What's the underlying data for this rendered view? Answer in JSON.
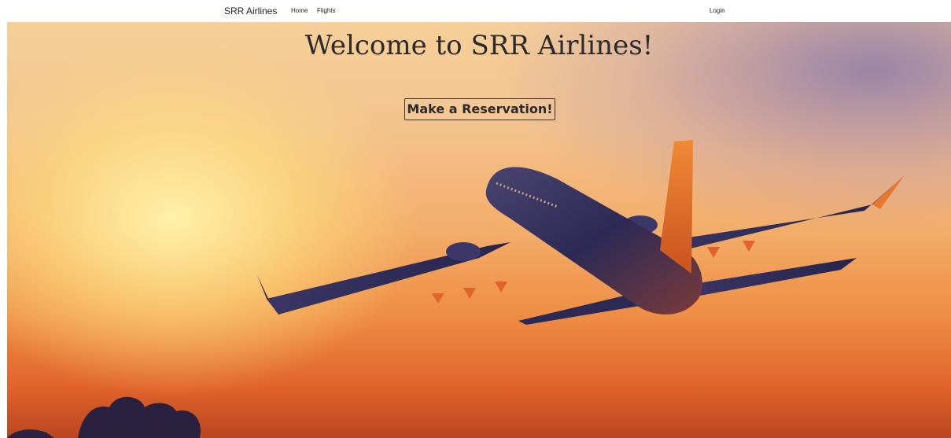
{
  "navbar": {
    "brand": "SRR Airlines",
    "links": [
      {
        "label": "Home"
      },
      {
        "label": "Flights"
      }
    ],
    "login": "Login"
  },
  "hero": {
    "title": "Welcome to SRR Airlines!",
    "reserve_button": "Make a Reservation!",
    "image_subject": "airplane-taking-off-at-sunset"
  },
  "colors": {
    "sky_top": "#f6cf9a",
    "sky_bottom": "#b8461f",
    "plane_body": "#2c2a55",
    "tail": "#e8772e"
  }
}
